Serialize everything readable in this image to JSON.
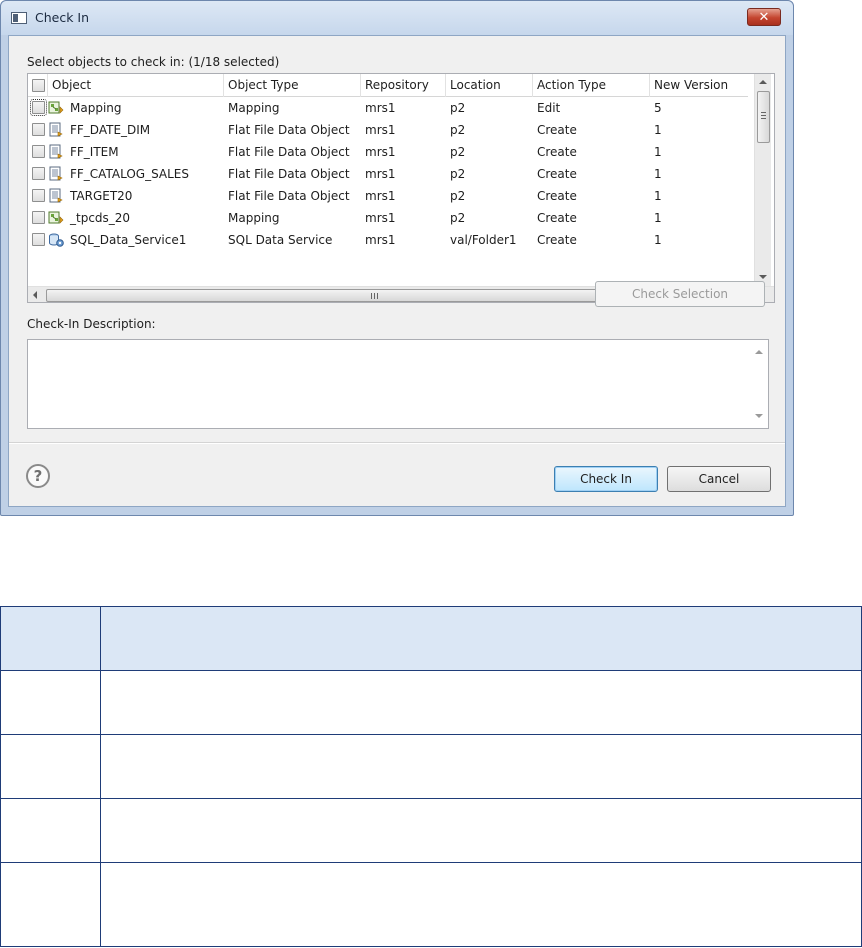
{
  "dialog": {
    "title": "Check In",
    "select_label": "Select objects to check in: (1/18 selected)",
    "columns": [
      "Object",
      "Object Type",
      "Repository",
      "Location",
      "Action Type",
      "New Version"
    ],
    "rows": [
      {
        "object": "Mapping",
        "icon": "mapping-icon",
        "type": "Mapping",
        "repository": "mrs1",
        "location": "p2",
        "action": "Edit",
        "version": "5"
      },
      {
        "object": "FF_DATE_DIM",
        "icon": "flat-file-icon",
        "type": "Flat File Data Object",
        "repository": "mrs1",
        "location": "p2",
        "action": "Create",
        "version": "1"
      },
      {
        "object": "FF_ITEM",
        "icon": "flat-file-icon",
        "type": "Flat File Data Object",
        "repository": "mrs1",
        "location": "p2",
        "action": "Create",
        "version": "1"
      },
      {
        "object": "FF_CATALOG_SALES",
        "icon": "flat-file-icon",
        "type": "Flat File Data Object",
        "repository": "mrs1",
        "location": "p2",
        "action": "Create",
        "version": "1"
      },
      {
        "object": "TARGET20",
        "icon": "flat-file-icon",
        "type": "Flat File Data Object",
        "repository": "mrs1",
        "location": "p2",
        "action": "Create",
        "version": "1"
      },
      {
        "object": "_tpcds_20",
        "icon": "mapping-icon",
        "type": "Mapping",
        "repository": "mrs1",
        "location": "p2",
        "action": "Create",
        "version": "1"
      },
      {
        "object": "SQL_Data_Service1",
        "icon": "sql-data-service-icon",
        "type": "SQL Data Service",
        "repository": "mrs1",
        "location": "val/Folder1",
        "action": "Create",
        "version": "1"
      }
    ],
    "check_selection_label": "Check Selection",
    "description_label": "Check-In Description:",
    "description_value": "",
    "check_in_label": "Check In",
    "cancel_label": "Cancel",
    "help_glyph": "?",
    "close_glyph": "✕",
    "scroll_grip_h": "III"
  },
  "colors": {
    "title_gradient_top": "#dde8f5",
    "close_button": "#c4452f",
    "table_border": "#1f3c78",
    "table_header_fill": "#dbe7f5"
  }
}
